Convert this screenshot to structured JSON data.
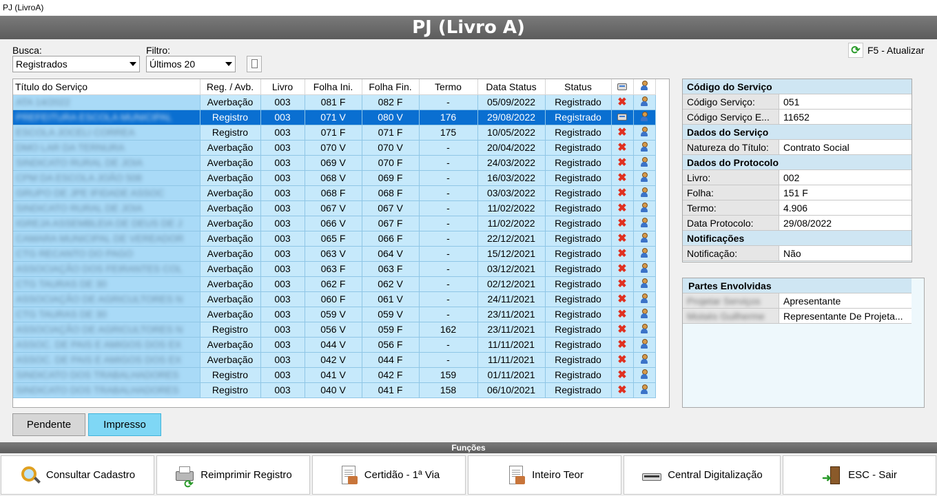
{
  "window": {
    "title": "PJ (LivroA)",
    "banner": "PJ (Livro A)"
  },
  "search": {
    "busca_label": "Busca:",
    "busca_value": "Registrados",
    "filtro_label": "Filtro:",
    "filtro_value": "Últimos 20",
    "refresh_label": "F5 - Atualizar"
  },
  "grid": {
    "columns": [
      "Título do Serviço",
      "Reg. / Avb.",
      "Livro",
      "Folha Ini.",
      "Folha Fin.",
      "Termo",
      "Data Status",
      "Status"
    ],
    "rows": [
      {
        "titulo": "ATA 14/2022",
        "tipo": "Averbação",
        "livro": "003",
        "folha_ini": "081 F",
        "folha_fin": "082 F",
        "termo": "-",
        "data": "05/09/2022",
        "status": "Registrado",
        "icon": "x"
      },
      {
        "titulo": "PREFEITURA ESCOLA MUNICIPAL",
        "tipo": "Registro",
        "livro": "003",
        "folha_ini": "071 V",
        "folha_fin": "080 V",
        "termo": "176",
        "data": "29/08/2022",
        "status": "Registrado",
        "icon": "printer",
        "selected": true
      },
      {
        "titulo": "ESCOLA JOCELI CORREA",
        "tipo": "Registro",
        "livro": "003",
        "folha_ini": "071 F",
        "folha_fin": "071 F",
        "termo": "175",
        "data": "10/05/2022",
        "status": "Registrado",
        "icon": "x"
      },
      {
        "titulo": "DMO LAR DA TERNURA",
        "tipo": "Averbação",
        "livro": "003",
        "folha_ini": "070 V",
        "folha_fin": "070 V",
        "termo": "-",
        "data": "20/04/2022",
        "status": "Registrado",
        "icon": "x"
      },
      {
        "titulo": "SINDICATO RURAL DE JOIA",
        "tipo": "Averbação",
        "livro": "003",
        "folha_ini": "069 V",
        "folha_fin": "070 F",
        "termo": "-",
        "data": "24/03/2022",
        "status": "Registrado",
        "icon": "x"
      },
      {
        "titulo": "CPM DA ESCOLA JOÃO 508",
        "tipo": "Averbação",
        "livro": "003",
        "folha_ini": "068 V",
        "folha_fin": "069 F",
        "termo": "-",
        "data": "16/03/2022",
        "status": "Registrado",
        "icon": "x"
      },
      {
        "titulo": "GRUPO DE JPE IFIDADE ASSOC",
        "tipo": "Averbação",
        "livro": "003",
        "folha_ini": "068 F",
        "folha_fin": "068 F",
        "termo": "-",
        "data": "03/03/2022",
        "status": "Registrado",
        "icon": "x"
      },
      {
        "titulo": "SINDICATO RURAL DE JOIA",
        "tipo": "Averbação",
        "livro": "003",
        "folha_ini": "067 V",
        "folha_fin": "067 V",
        "termo": "-",
        "data": "11/02/2022",
        "status": "Registrado",
        "icon": "x"
      },
      {
        "titulo": "IGREJA ASSEMBLEIA DE DEUS DE J",
        "tipo": "Averbação",
        "livro": "003",
        "folha_ini": "066 V",
        "folha_fin": "067 F",
        "termo": "-",
        "data": "11/02/2022",
        "status": "Registrado",
        "icon": "x"
      },
      {
        "titulo": "CAMARA MUNICIPAL DE VEREADOR",
        "tipo": "Averbação",
        "livro": "003",
        "folha_ini": "065 F",
        "folha_fin": "066 F",
        "termo": "-",
        "data": "22/12/2021",
        "status": "Registrado",
        "icon": "x"
      },
      {
        "titulo": "CTG RECANTO DO PAGO",
        "tipo": "Averbação",
        "livro": "003",
        "folha_ini": "063 V",
        "folha_fin": "064 V",
        "termo": "-",
        "data": "15/12/2021",
        "status": "Registrado",
        "icon": "x"
      },
      {
        "titulo": "ASSOCIAÇÃO DOS FEIRANTES COL",
        "tipo": "Averbação",
        "livro": "003",
        "folha_ini": "063 F",
        "folha_fin": "063 F",
        "termo": "-",
        "data": "03/12/2021",
        "status": "Registrado",
        "icon": "x"
      },
      {
        "titulo": "CTG TAURAS DE 30",
        "tipo": "Averbação",
        "livro": "003",
        "folha_ini": "062 F",
        "folha_fin": "062 V",
        "termo": "-",
        "data": "02/12/2021",
        "status": "Registrado",
        "icon": "x"
      },
      {
        "titulo": "ASSOCIAÇÃO DE AGRICULTORES N",
        "tipo": "Averbação",
        "livro": "003",
        "folha_ini": "060 F",
        "folha_fin": "061 V",
        "termo": "-",
        "data": "24/11/2021",
        "status": "Registrado",
        "icon": "x"
      },
      {
        "titulo": "CTG TAURAS DE 30",
        "tipo": "Averbação",
        "livro": "003",
        "folha_ini": "059 V",
        "folha_fin": "059 V",
        "termo": "-",
        "data": "23/11/2021",
        "status": "Registrado",
        "icon": "x"
      },
      {
        "titulo": "ASSOCIAÇÃO DE AGRICULTORES N",
        "tipo": "Registro",
        "livro": "003",
        "folha_ini": "056 V",
        "folha_fin": "059 F",
        "termo": "162",
        "data": "23/11/2021",
        "status": "Registrado",
        "icon": "x"
      },
      {
        "titulo": "ASSOC. DE PAIS E AMIGOS DOS EX",
        "tipo": "Averbação",
        "livro": "003",
        "folha_ini": "044 V",
        "folha_fin": "056 F",
        "termo": "-",
        "data": "11/11/2021",
        "status": "Registrado",
        "icon": "x"
      },
      {
        "titulo": "ASSOC. DE PAIS E AMIGOS DOS EX",
        "tipo": "Averbação",
        "livro": "003",
        "folha_ini": "042 V",
        "folha_fin": "044 F",
        "termo": "-",
        "data": "11/11/2021",
        "status": "Registrado",
        "icon": "x"
      },
      {
        "titulo": "SINDICATO DOS TRABALHADORES",
        "tipo": "Registro",
        "livro": "003",
        "folha_ini": "041 V",
        "folha_fin": "042 F",
        "termo": "159",
        "data": "01/11/2021",
        "status": "Registrado",
        "icon": "x"
      },
      {
        "titulo": "SINDICATO DOS TRABALHADORES",
        "tipo": "Registro",
        "livro": "003",
        "folha_ini": "040 V",
        "folha_fin": "041 F",
        "termo": "158",
        "data": "06/10/2021",
        "status": "Registrado",
        "icon": "x"
      }
    ]
  },
  "status_buttons": {
    "pendente": "Pendente",
    "impresso": "Impresso"
  },
  "details": {
    "codigo_head": "Código do Serviço",
    "codigo_servico_label": "Código Serviço:",
    "codigo_servico_value": "051",
    "codigo_e_label": "Código Serviço E...",
    "codigo_e_value": "11652",
    "dados_servico_head": "Dados do Serviço",
    "natureza_label": "Natureza do Título:",
    "natureza_value": "Contrato Social",
    "dados_protocolo_head": "Dados do Protocolo",
    "livro_label": "Livro:",
    "livro_value": "002",
    "folha_label": "Folha:",
    "folha_value": "151 F",
    "termo_label": "Termo:",
    "termo_value": "4.906",
    "data_protocolo_label": "Data Protocolo:",
    "data_protocolo_value": "29/08/2022",
    "notificacoes_head": "Notificações",
    "notificacao_label": "Notificação:",
    "notificacao_value": "Não"
  },
  "partes": {
    "head": "Partes Envolvidas",
    "rows": [
      {
        "nome": "Projetar Serviços",
        "papel": "Apresentante"
      },
      {
        "nome": "Moisés Guilherme",
        "papel": "Representante De Projeta..."
      }
    ]
  },
  "funcoes": {
    "bar_label": "Funções",
    "buttons": [
      "Consultar Cadastro",
      "Reimprimir Registro",
      "Certidão - 1ª Via",
      "Inteiro Teor",
      "Central Digitalização",
      "ESC - Sair"
    ]
  }
}
